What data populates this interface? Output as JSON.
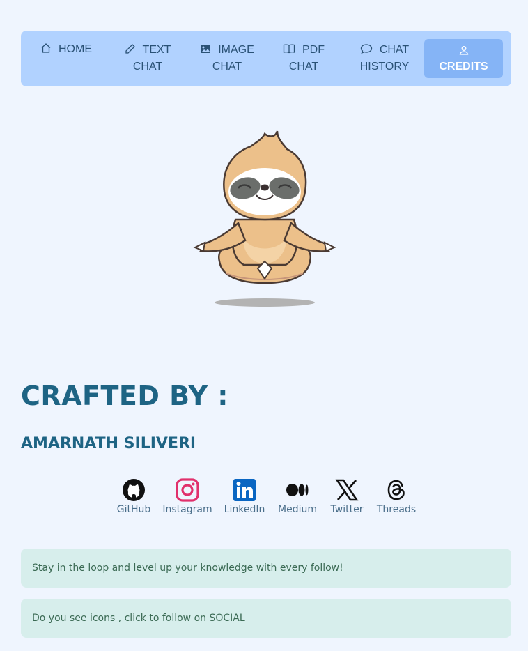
{
  "nav": {
    "items": [
      {
        "line1": "HOME",
        "line2": ""
      },
      {
        "line1": "TEXT",
        "line2": "CHAT"
      },
      {
        "line1": "IMAGE",
        "line2": "CHAT"
      },
      {
        "line1": "PDF",
        "line2": "CHAT"
      },
      {
        "line1": "CHAT",
        "line2": "HISTORY"
      }
    ],
    "active": {
      "label": "CREDITS"
    },
    "colors": {
      "bar": "#b1d2ff",
      "active": "#85b4f6",
      "text": "#2a5276"
    }
  },
  "main": {
    "heading": "CRAFTED BY :",
    "author": "AMARNATH SILIVERI",
    "heading_color": "#1e6484"
  },
  "social": [
    {
      "label": "GitHub",
      "icon": "github-icon"
    },
    {
      "label": "Instagram",
      "icon": "instagram-icon"
    },
    {
      "label": "LinkedIn",
      "icon": "linkedin-icon"
    },
    {
      "label": "Medium",
      "icon": "medium-icon"
    },
    {
      "label": "Twitter",
      "icon": "x-twitter-icon"
    },
    {
      "label": "Threads",
      "icon": "threads-icon"
    }
  ],
  "info": [
    "Stay in the loop and level up your knowledge with every follow!",
    "Do you see icons , click to follow on SOCIAL"
  ]
}
